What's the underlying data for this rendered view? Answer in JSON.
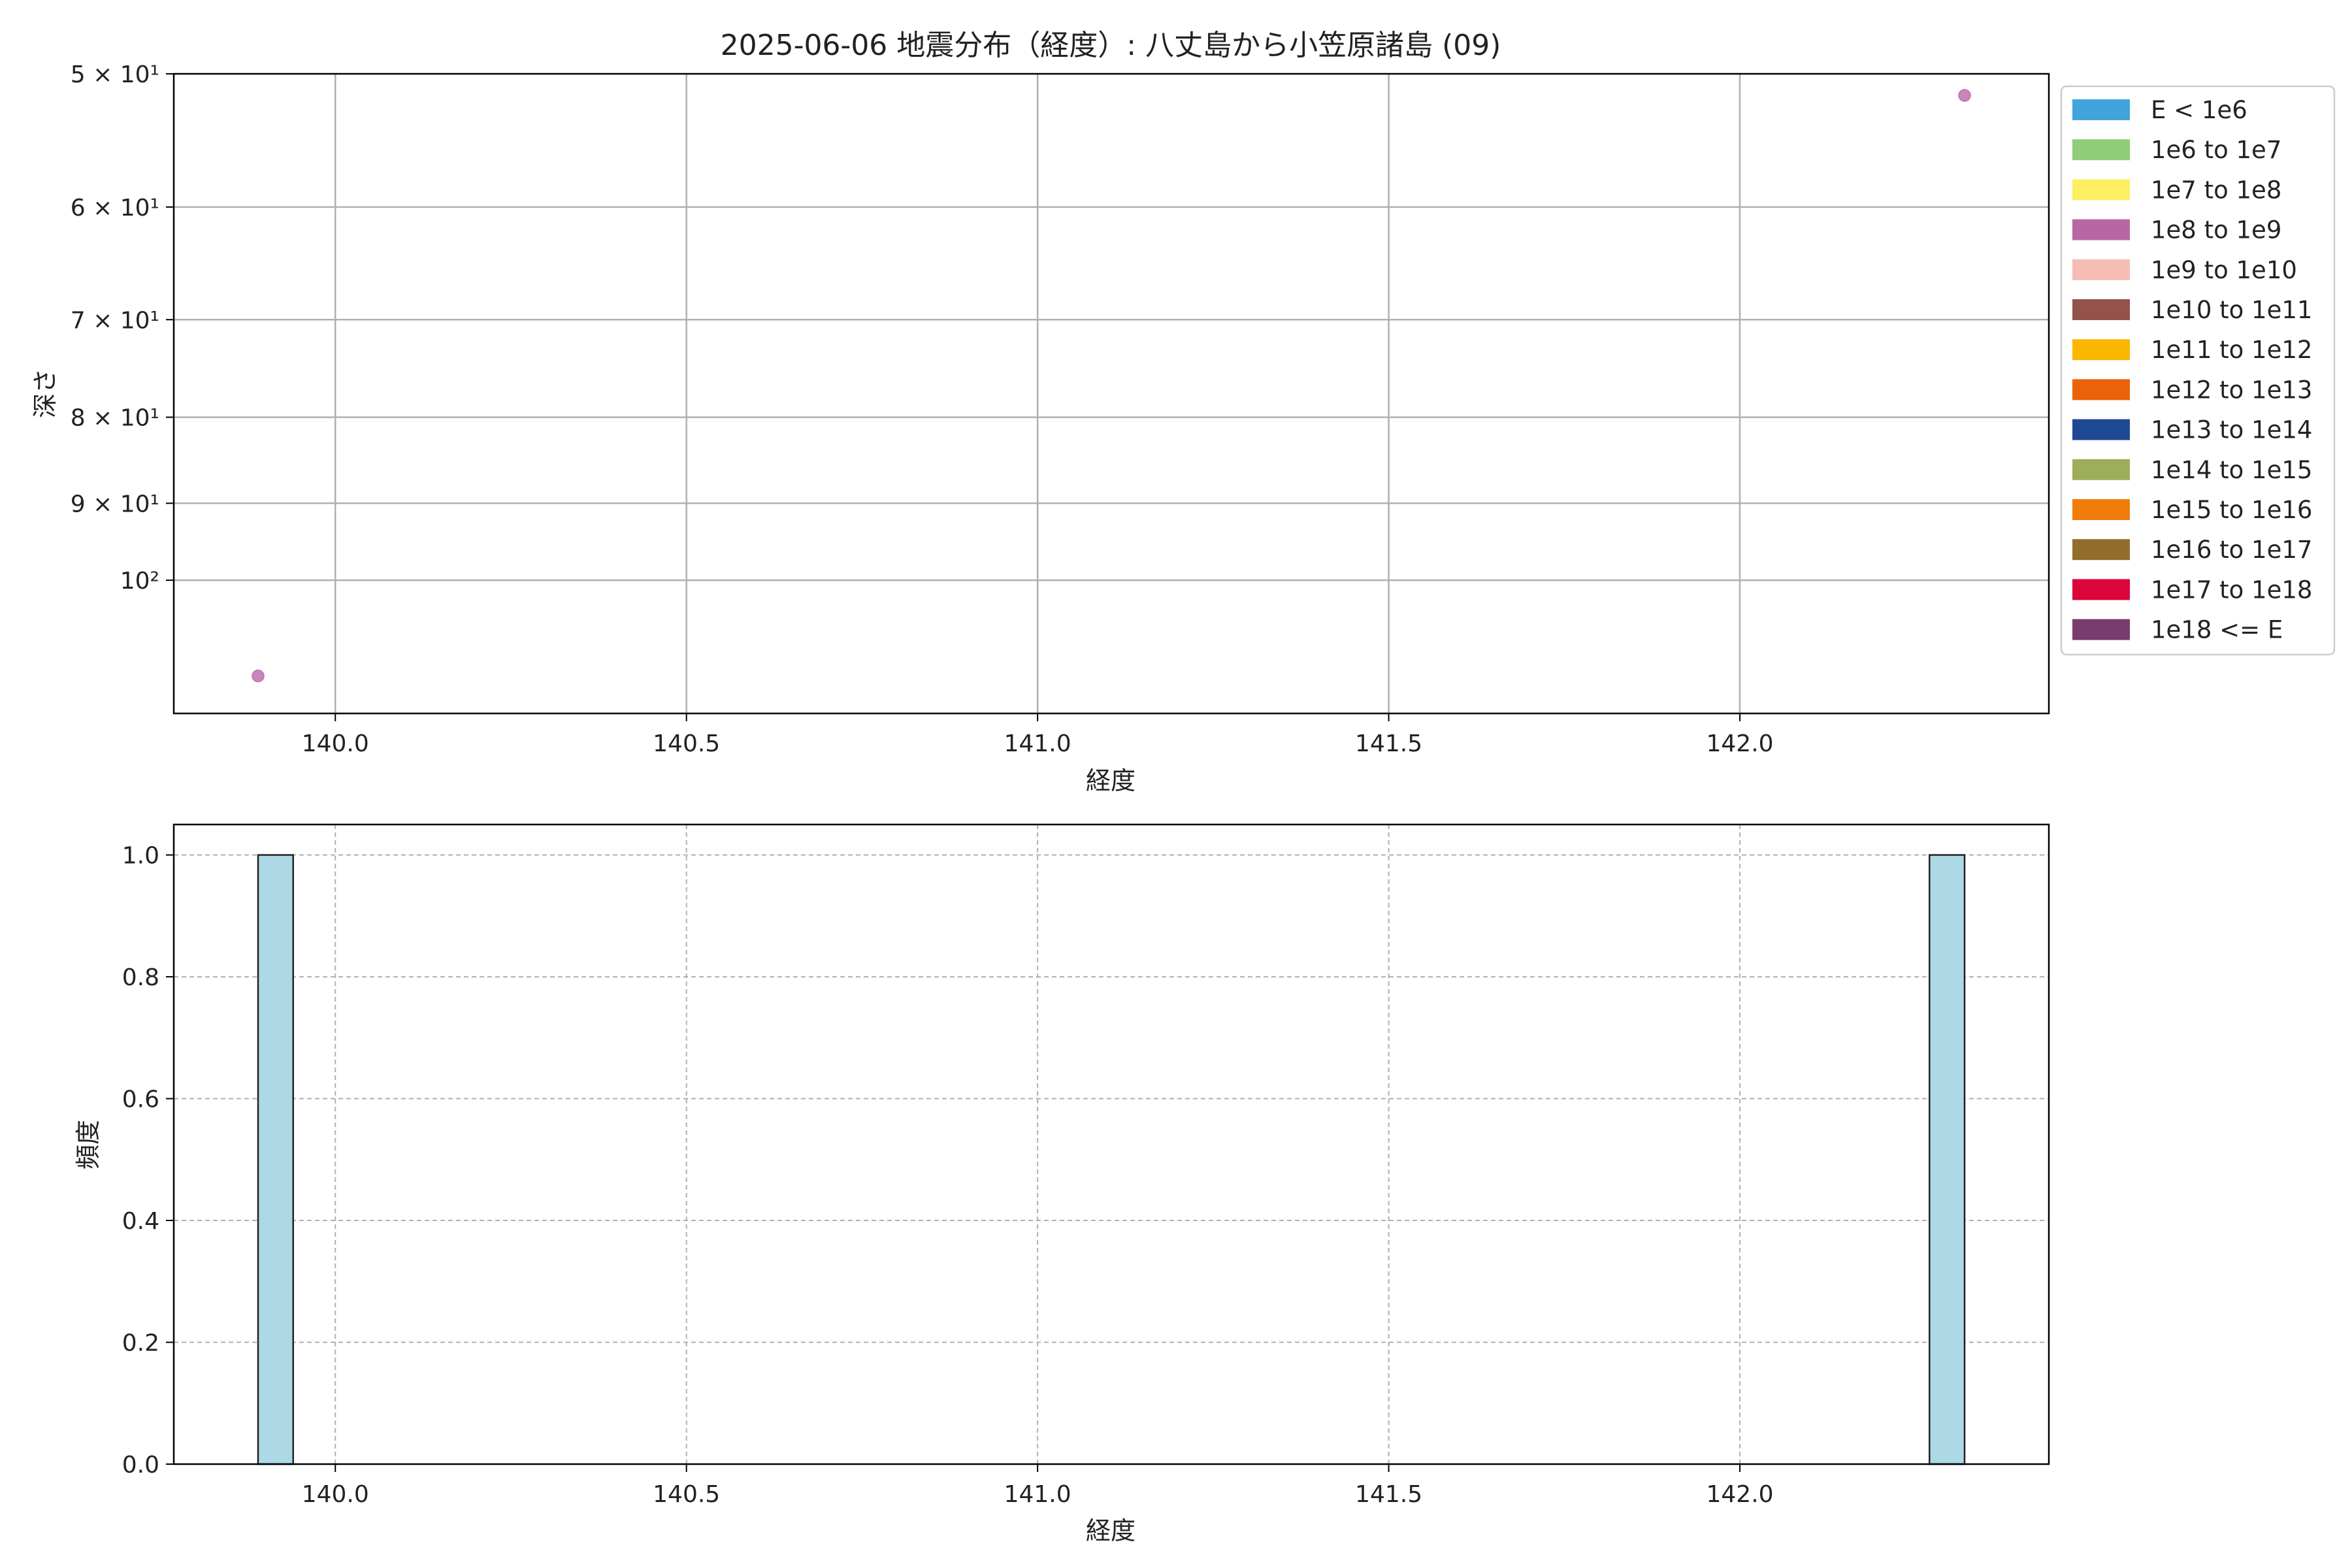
{
  "figure": {
    "title": "2025-06-06 地震分布（経度）: 八丈島から小笠原諸島 (09)"
  },
  "chart_data": [
    {
      "type": "scatter",
      "xlabel": "経度",
      "ylabel": "深さ",
      "xlim": [
        139.77,
        142.44
      ],
      "ylim": [
        50,
        120
      ],
      "y_scale": "log",
      "y_inverted": true,
      "grid": true,
      "x_ticks": [
        {
          "value": 140.0,
          "label": "140.0"
        },
        {
          "value": 140.5,
          "label": "140.5"
        },
        {
          "value": 141.0,
          "label": "141.0"
        },
        {
          "value": 141.5,
          "label": "141.5"
        },
        {
          "value": 142.0,
          "label": "142.0"
        }
      ],
      "y_ticks": [
        {
          "value": 50,
          "label": "5 × 10¹"
        },
        {
          "value": 60,
          "label": "6 × 10¹"
        },
        {
          "value": 70,
          "label": "7 × 10¹"
        },
        {
          "value": 80,
          "label": "8 × 10¹"
        },
        {
          "value": 90,
          "label": "9 × 10¹"
        },
        {
          "value": 100,
          "label": "10²"
        }
      ],
      "points": [
        {
          "x": 139.89,
          "y": 114,
          "color": "#c070b0"
        },
        {
          "x": 142.32,
          "y": 51.5,
          "color": "#c070b0"
        }
      ],
      "legend_position": "outside-right",
      "legend": [
        {
          "label": "E < 1e6",
          "color": "#41a4dc"
        },
        {
          "label": "1e6 to 1e7",
          "color": "#8fcd78"
        },
        {
          "label": "1e7 to 1e8",
          "color": "#fdee62"
        },
        {
          "label": "1e8 to 1e9",
          "color": "#b866a4"
        },
        {
          "label": "1e9 to 1e10",
          "color": "#f6bdb6"
        },
        {
          "label": "1e10 to 1e11",
          "color": "#93524a"
        },
        {
          "label": "1e11 to 1e12",
          "color": "#fbb600"
        },
        {
          "label": "1e12 to 1e13",
          "color": "#eb6208"
        },
        {
          "label": "1e13 to 1e14",
          "color": "#1f4892"
        },
        {
          "label": "1e14 to 1e15",
          "color": "#9ead58"
        },
        {
          "label": "1e15 to 1e16",
          "color": "#f17c0c"
        },
        {
          "label": "1e16 to 1e17",
          "color": "#936d2c"
        },
        {
          "label": "1e17 to 1e18",
          "color": "#db0539"
        },
        {
          "label": "1e18 <= E",
          "color": "#783c6e"
        }
      ]
    },
    {
      "type": "bar",
      "xlabel": "経度",
      "ylabel": "頻度",
      "xlim": [
        139.77,
        142.44
      ],
      "ylim": [
        0,
        1.05
      ],
      "grid": true,
      "grid_style": "dashed",
      "bar_color": "#add8e6",
      "x_ticks": [
        {
          "value": 140.0,
          "label": "140.0"
        },
        {
          "value": 140.5,
          "label": "140.5"
        },
        {
          "value": 141.0,
          "label": "141.0"
        },
        {
          "value": 141.5,
          "label": "141.5"
        },
        {
          "value": 142.0,
          "label": "142.0"
        }
      ],
      "y_ticks": [
        {
          "value": 0.0,
          "label": "0.0"
        },
        {
          "value": 0.2,
          "label": "0.2"
        },
        {
          "value": 0.4,
          "label": "0.4"
        },
        {
          "value": 0.6,
          "label": "0.6"
        },
        {
          "value": 0.8,
          "label": "0.8"
        },
        {
          "value": 1.0,
          "label": "1.0"
        }
      ],
      "bins": [
        {
          "x0": 139.89,
          "x1": 139.94,
          "count": 1
        },
        {
          "x0": 142.27,
          "x1": 142.32,
          "count": 1
        }
      ]
    }
  ]
}
